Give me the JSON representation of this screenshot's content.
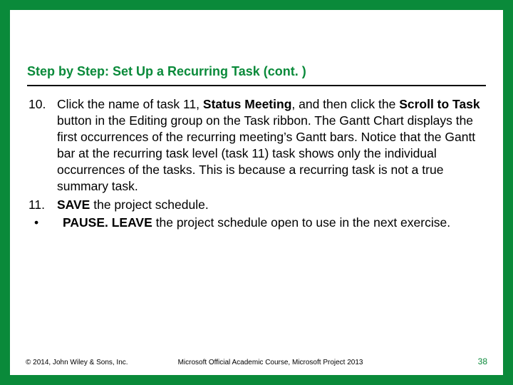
{
  "title": "Step by Step: Set Up a Recurring Task (cont. )",
  "items": {
    "i10": {
      "marker": "10.",
      "pre": "Click the name of task 11, ",
      "b1": "Status Meeting",
      "mid1": ", and then click the ",
      "b2": "Scroll to Task",
      "post": " button in the Editing group on the Task ribbon. The Gantt Chart displays the first occurrences of the recurring meeting’s Gantt bars. Notice that the Gantt bar at the recurring task level (task 11) task shows only the individual occurrences of the tasks. This is because a recurring task is not a true summary task."
    },
    "i11": {
      "marker": "11.",
      "b1": "SAVE",
      "post": " the project schedule."
    },
    "bullet": {
      "marker": "•",
      "b1": "PAUSE. LEAVE",
      "post": " the project schedule open to use in the next exercise."
    }
  },
  "footer": {
    "copyright": "© 2014, John Wiley & Sons, Inc.",
    "course": "Microsoft Official Academic Course, Microsoft Project 2013",
    "page": "38"
  }
}
